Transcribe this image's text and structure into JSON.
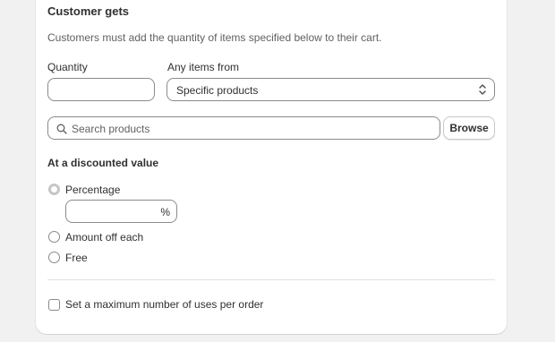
{
  "card": {
    "title": "Customer gets",
    "description": "Customers must add the quantity of items specified below to their cart."
  },
  "quantity": {
    "label": "Quantity",
    "value": ""
  },
  "items_from": {
    "label": "Any items from",
    "selected": "Specific products",
    "icon": "chevron-up-down-icon"
  },
  "search": {
    "placeholder": "Search products",
    "icon": "search-icon",
    "browse_label": "Browse"
  },
  "discount": {
    "title": "At a discounted value",
    "options": [
      {
        "label": "Percentage",
        "selected": true
      },
      {
        "label": "Amount off each",
        "selected": false
      },
      {
        "label": "Free",
        "selected": false
      }
    ],
    "percentage_value": "",
    "percentage_suffix": "%"
  },
  "max_uses": {
    "label": "Set a maximum number of uses per order",
    "checked": false
  }
}
